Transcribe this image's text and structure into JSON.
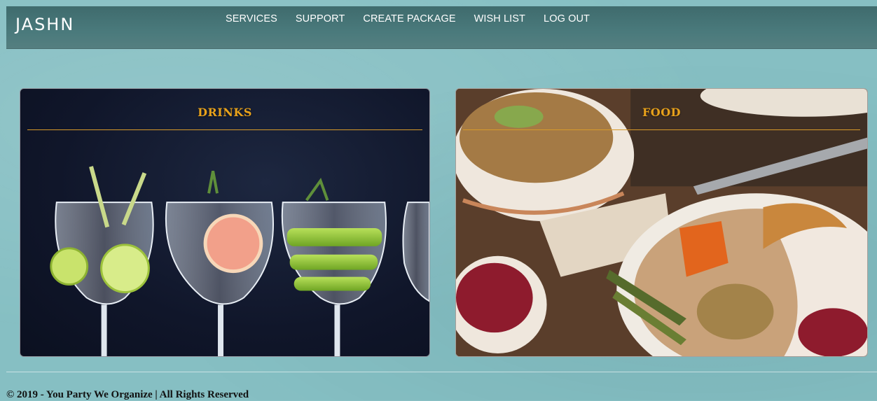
{
  "brand": "JASHN",
  "nav": {
    "items": [
      {
        "label": "SERVICES"
      },
      {
        "label": "SUPPORT"
      },
      {
        "label": "CREATE PACKAGE"
      },
      {
        "label": "WISH LIST"
      },
      {
        "label": "LOG OUT"
      }
    ]
  },
  "cards": [
    {
      "title": "DRINKS",
      "image": "cocktail-glasses-photo"
    },
    {
      "title": "FOOD",
      "image": "roast-turkey-dinner-photo"
    }
  ],
  "footer": {
    "text": "© 2019 - You Party We Organize | All Rights Reserved"
  },
  "colors": {
    "background": "#86bfc3",
    "navbar": "#4a7a7c",
    "card_title": "#e8a21b",
    "nav_text": "#ffffff"
  }
}
